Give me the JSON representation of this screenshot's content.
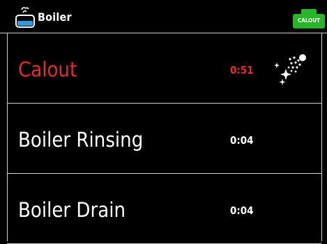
{
  "header": {
    "title": "Boiler",
    "boiler_icon": "boiler-icon",
    "badge": {
      "label": "CALOUT",
      "color": "#29b529",
      "icon": "calout-cartridge-icon"
    }
  },
  "items": [
    {
      "label": "Calout",
      "time": "0:51",
      "active": true,
      "icon": "spray-sparkle-icon"
    },
    {
      "label": "Boiler Rinsing",
      "time": "0:04",
      "active": false
    },
    {
      "label": "Boiler Drain",
      "time": "0:04",
      "active": false
    }
  ],
  "colors": {
    "active_text": "#e02e2e",
    "text": "#ffffff",
    "background": "#000000",
    "divider": "#d0d0d0"
  }
}
